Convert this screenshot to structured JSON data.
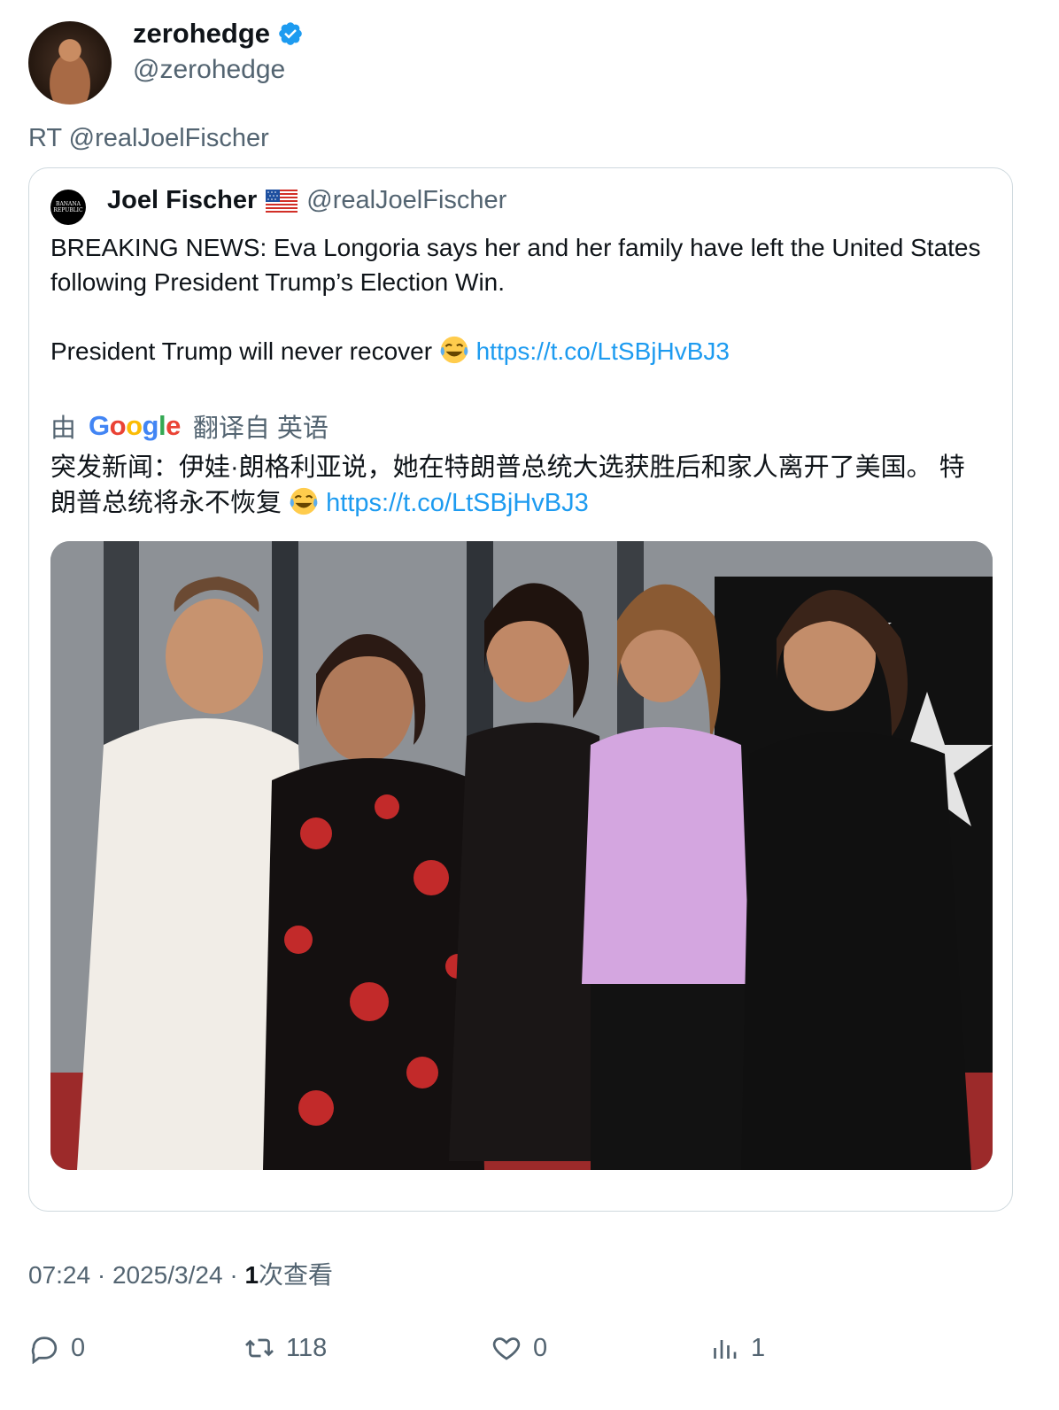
{
  "author": {
    "display_name": "zerohedge",
    "handle": "@zerohedge"
  },
  "retweet_line": "RT @realJoelFischer",
  "quoted": {
    "avatar_text": "BANANA REPUBLIC",
    "display_name": "Joel Fischer",
    "flag_icon": "us-flag-icon",
    "handle": "@realJoelFischer",
    "text_line1": "BREAKING NEWS: Eva Longoria says her and her family have left the United States following President Trump’s Election Win.",
    "text_line2": "President Trump will never recover",
    "link": "https://t.co/LtSBjHvBJ3",
    "translate_prefix": "由",
    "translate_brand": "Google",
    "translate_suffix": "翻译自 英语",
    "translated_text": "突发新闻：伊娃·朗格利亚说，她在特朗普总统大选获胜后和家人离开了美国。 特朗普总统将永不恢复",
    "translated_link": "https://t.co/LtSBjHvBJ3"
  },
  "meta": {
    "time": "07:24",
    "date": "2025/3/24",
    "views_count": "1",
    "views_label": "次查看"
  },
  "actions": {
    "replies": "0",
    "retweets": "118",
    "likes": "0",
    "views": "1"
  },
  "colors": {
    "link": "#1d9bf0",
    "verified": "#1d9bf0",
    "muted": "#536471"
  }
}
